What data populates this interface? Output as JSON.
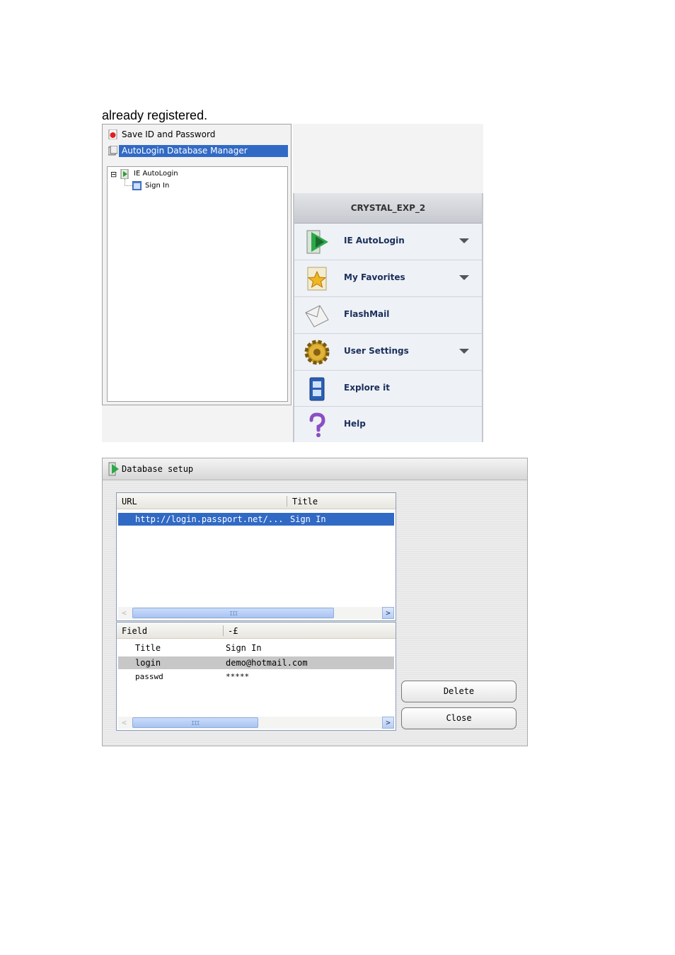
{
  "intro_text": "already registered.",
  "context_menu": {
    "items": [
      {
        "label": "Save ID and Password",
        "icon": "save-password-icon"
      },
      {
        "label": "AutoLogin Database Manager",
        "icon": "database-icon"
      }
    ],
    "tree": {
      "root": {
        "expander": "⊟",
        "label": "IE AutoLogin"
      },
      "child": {
        "label": "Sign In"
      }
    }
  },
  "crystal_panel": {
    "title": "CRYSTAL_EXP_2",
    "items": [
      {
        "label": "IE AutoLogin",
        "icon": "autologin-icon",
        "has_dropdown": true
      },
      {
        "label": "My Favorites",
        "icon": "favorites-star-icon",
        "has_dropdown": true
      },
      {
        "label": "FlashMail",
        "icon": "mail-envelope-icon",
        "has_dropdown": false
      },
      {
        "label": "User Settings",
        "icon": "gear-icon",
        "has_dropdown": true
      },
      {
        "label": "Explore it",
        "icon": "explorer-icon",
        "has_dropdown": false
      },
      {
        "label": "Help",
        "icon": "help-question-icon",
        "has_dropdown": false
      }
    ]
  },
  "database_dialog": {
    "title": "Database setup",
    "url_list": {
      "columns": [
        "URL",
        "Title"
      ],
      "rows": [
        {
          "url": "http://login.passport.net/...",
          "title": "Sign In",
          "selected": true
        }
      ]
    },
    "field_list": {
      "columns": [
        "Field",
        "-£"
      ],
      "rows": [
        {
          "field": "Title",
          "value": "Sign In",
          "selected": false
        },
        {
          "field": "login",
          "value": "demo@hotmail.com",
          "selected": true
        },
        {
          "field": "passwd",
          "value": "*****",
          "selected": false
        }
      ]
    },
    "buttons": {
      "delete": "Delete",
      "close": "Close"
    },
    "scroll_grip": "III",
    "scroll_left": "<",
    "scroll_right": ">"
  },
  "colors": {
    "selection": "#316ac5",
    "row_highlight": "#c7c7c7",
    "crystal_label": "#1a2f5a"
  }
}
